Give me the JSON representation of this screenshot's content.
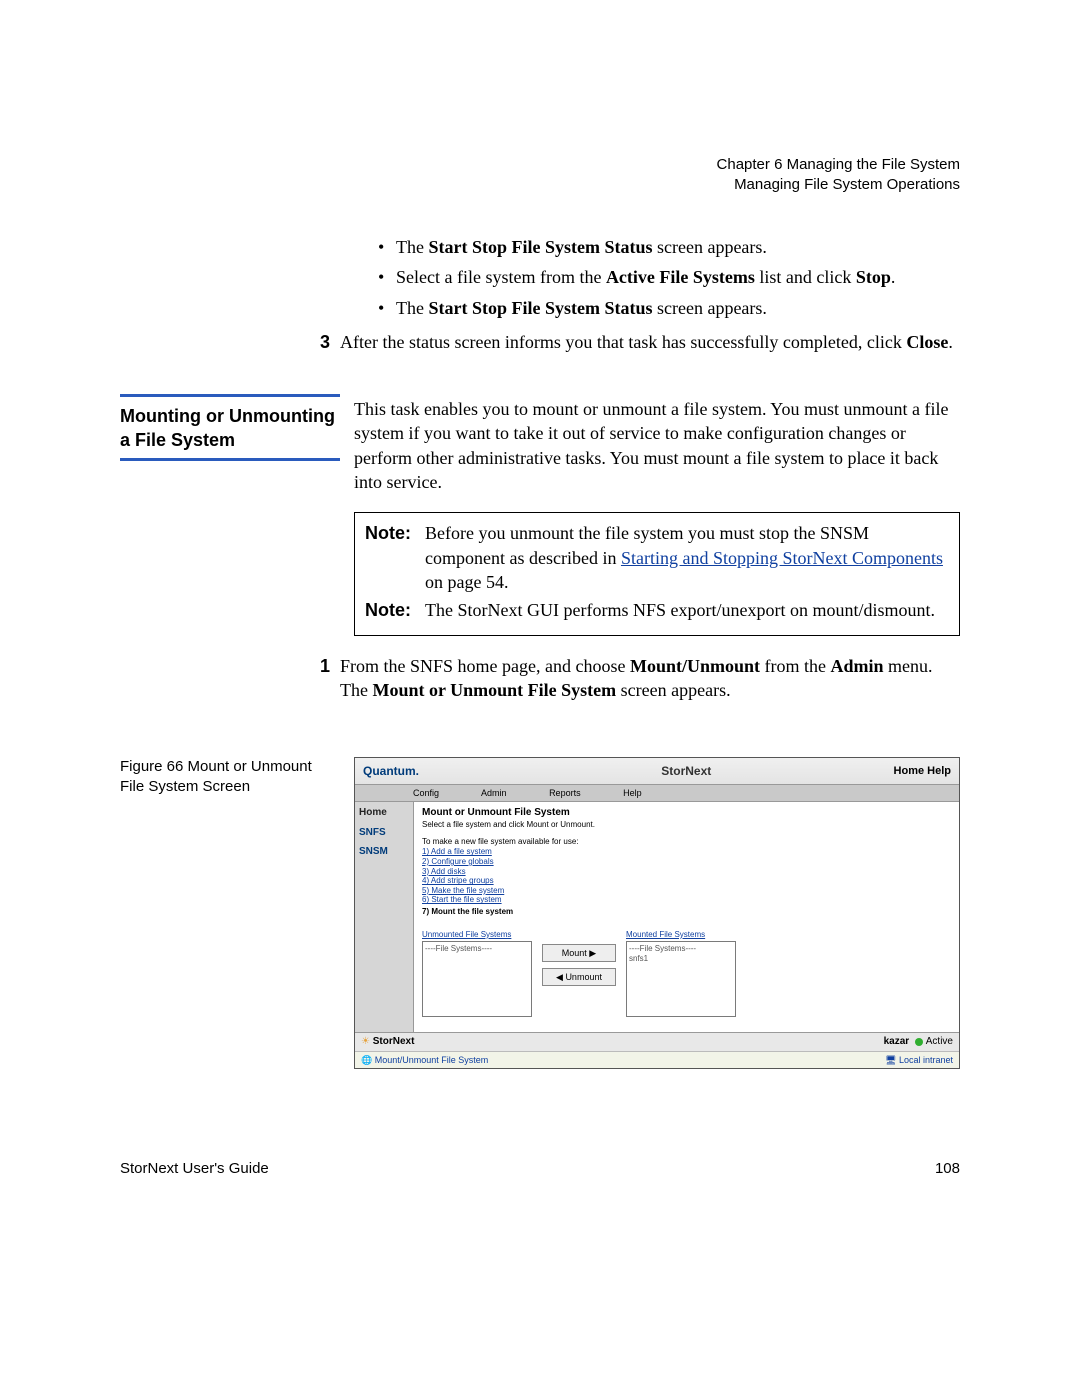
{
  "header": {
    "chapter": "Chapter 6  Managing the File System",
    "section": "Managing File System Operations"
  },
  "bullets": [
    {
      "pre": "The ",
      "b1": "Start Stop File System Status",
      "post": " screen appears."
    },
    {
      "pre": "Select a file system from the ",
      "b1": "Active File Systems",
      "mid": " list and click ",
      "b2": "Stop",
      "post": "."
    },
    {
      "pre": "The ",
      "b1": "Start Stop File System Status",
      "post": " screen appears."
    }
  ],
  "step3": {
    "num": "3",
    "pre": "After the status screen informs you that task has successfully completed, click ",
    "b1": "Close",
    "post": "."
  },
  "side_heading": "Mounting or Unmounting a File System",
  "intro_para": "This task enables you to mount or unmount a file system. You must unmount a file system if you want to take it out of service to make configuration changes or perform other administrative tasks. You must mount a file system to place it back into service.",
  "note1": {
    "label": "Note:",
    "pre": "Before you unmount the file system you must stop the SNSM component as described in ",
    "link": "Starting and Stopping StorNext Components",
    "post": " on page  54."
  },
  "note2": {
    "label": "Note:",
    "text": "The StorNext GUI performs NFS export/unexport on mount/dismount."
  },
  "step1": {
    "num": "1",
    "pre": "From the SNFS home page, and choose ",
    "b1": "Mount/Unmount",
    "mid": " from the ",
    "b2": "Admin",
    "mid2": " menu. The ",
    "b3": "Mount or Unmount File System",
    "post": " screen appears."
  },
  "figure_caption": "Figure 66  Mount or Unmount File System Screen",
  "screenshot": {
    "brand": "Quantum.",
    "title": "StorNext",
    "header_links": "Home  Help",
    "menus": {
      "m1": "Config",
      "m2": "Admin",
      "m3": "Reports",
      "m4": "Help"
    },
    "side": {
      "i1": "Home",
      "i2": "SNFS",
      "i3": "SNSM"
    },
    "panel_title": "Mount or Unmount File System",
    "panel_sub": "Select a file system and click Mount or Unmount.",
    "steps_intro": "To make a new file system available for use:",
    "steps": {
      "s1": "1) Add a file system",
      "s2": "2) Configure globals",
      "s3": "3) Add disks",
      "s4": "4) Add stripe groups",
      "s5": "5) Make the file system",
      "s6": "6) Start the file system",
      "s7": "7) Mount the file system"
    },
    "unmounted_label": "Unmounted File Systems",
    "mounted_label": "Mounted File Systems",
    "list_placeholder": "----File Systems----",
    "mounted_item": "snfs1",
    "mount_btn": "Mount  ▶",
    "unmount_btn": "◀  Unmount",
    "footer_left_logo": "StorNext",
    "footer_host": "kazar",
    "footer_state": "Active",
    "status_left": "Mount/Unmount File System",
    "status_right": "Local intranet"
  },
  "page_footer": {
    "left": "StorNext User's Guide",
    "right": "108"
  }
}
